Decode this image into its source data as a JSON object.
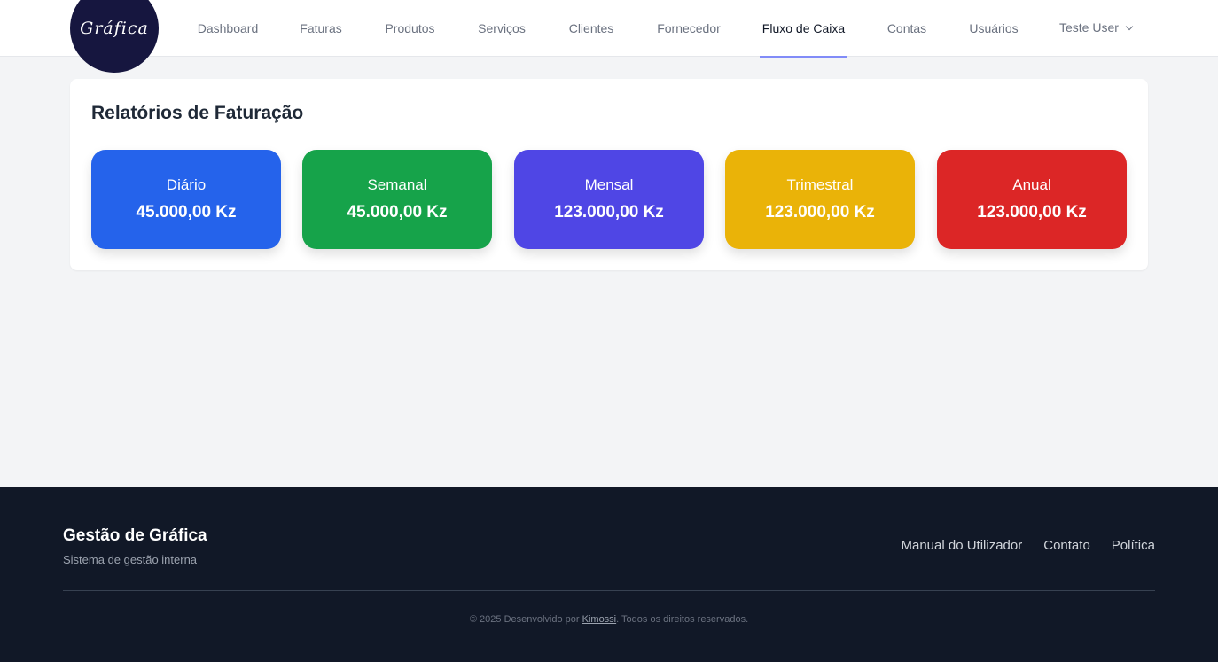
{
  "brand": {
    "logo_text": "Gráfica",
    "logo_bg": "#16163f"
  },
  "nav": {
    "items": [
      {
        "label": "Dashboard",
        "active": false
      },
      {
        "label": "Faturas",
        "active": false
      },
      {
        "label": "Produtos",
        "active": false
      },
      {
        "label": "Serviços",
        "active": false
      },
      {
        "label": "Clientes",
        "active": false
      },
      {
        "label": "Fornecedor",
        "active": false
      },
      {
        "label": "Fluxo de Caixa",
        "active": true
      },
      {
        "label": "Contas",
        "active": false
      },
      {
        "label": "Usuários",
        "active": false
      }
    ],
    "user": "Teste User",
    "active_indicator_color": "#818cf8"
  },
  "report": {
    "title": "Relatórios de Faturação",
    "cards": [
      {
        "label": "Diário",
        "value": "45.000,00 Kz",
        "color": "#2563eb"
      },
      {
        "label": "Semanal",
        "value": "45.000,00 Kz",
        "color": "#16a34a"
      },
      {
        "label": "Mensal",
        "value": "123.000,00 Kz",
        "color": "#4f46e5"
      },
      {
        "label": "Trimestral",
        "value": "123.000,00 Kz",
        "color": "#eab308"
      },
      {
        "label": "Anual",
        "value": "123.000,00 Kz",
        "color": "#dc2626"
      }
    ]
  },
  "footer": {
    "title": "Gestão de Gráfica",
    "subtitle": "Sistema de gestão interna",
    "links": [
      "Manual do Utilizador",
      "Contato",
      "Política"
    ],
    "copyright_prefix": "© 2025 Desenvolvido por ",
    "copyright_author": "Kimossi",
    "copyright_suffix": ". Todos os direitos reservados."
  }
}
